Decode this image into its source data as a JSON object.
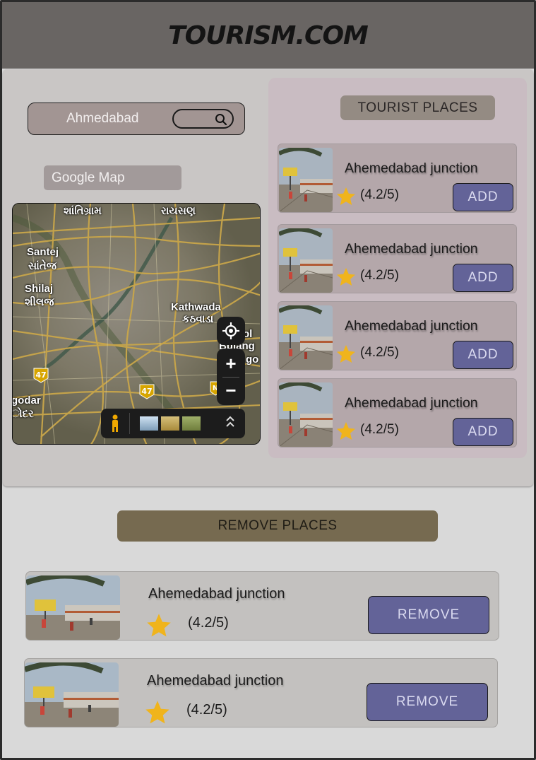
{
  "header": {
    "brand": "TOURISM.COM"
  },
  "search": {
    "value": "Ahmedabad"
  },
  "map": {
    "label": "Google Map",
    "place_labels": [
      "શાંતિગ્રામ",
      "રાયસણ",
      "Santej",
      "સાંતેજ",
      "Shilaj",
      "શીલજ",
      "Kathwada",
      "કઠવાડા",
      "ol",
      "Bulang",
      "go",
      "godar",
      "ોદર"
    ],
    "highway_badges": [
      "47",
      "47",
      "N"
    ],
    "zoom_in": "+",
    "zoom_out": "−",
    "expand": "⌃"
  },
  "tourist_places": {
    "heading": "TOURIST PLACES",
    "items": [
      {
        "name": "Ahemedabad junction",
        "rating": "(4.2/5)",
        "button": "ADD"
      },
      {
        "name": "Ahemedabad junction",
        "rating": "(4.2/5)",
        "button": "ADD"
      },
      {
        "name": "Ahemedabad junction",
        "rating": "(4.2/5)",
        "button": "ADD"
      },
      {
        "name": "Ahemedabad junction",
        "rating": "(4.2/5)",
        "button": "ADD"
      }
    ]
  },
  "remove_places": {
    "heading": "REMOVE PLACES",
    "items": [
      {
        "name": "Ahemedabad junction",
        "rating": "(4.2/5)",
        "button": "REMOVE"
      },
      {
        "name": "Ahemedabad junction",
        "rating": "(4.2/5)",
        "button": "REMOVE"
      }
    ]
  },
  "colors": {
    "header": "#696563",
    "button": "#636398",
    "remove_heading": "#766a50",
    "star": "#f0b41c"
  }
}
